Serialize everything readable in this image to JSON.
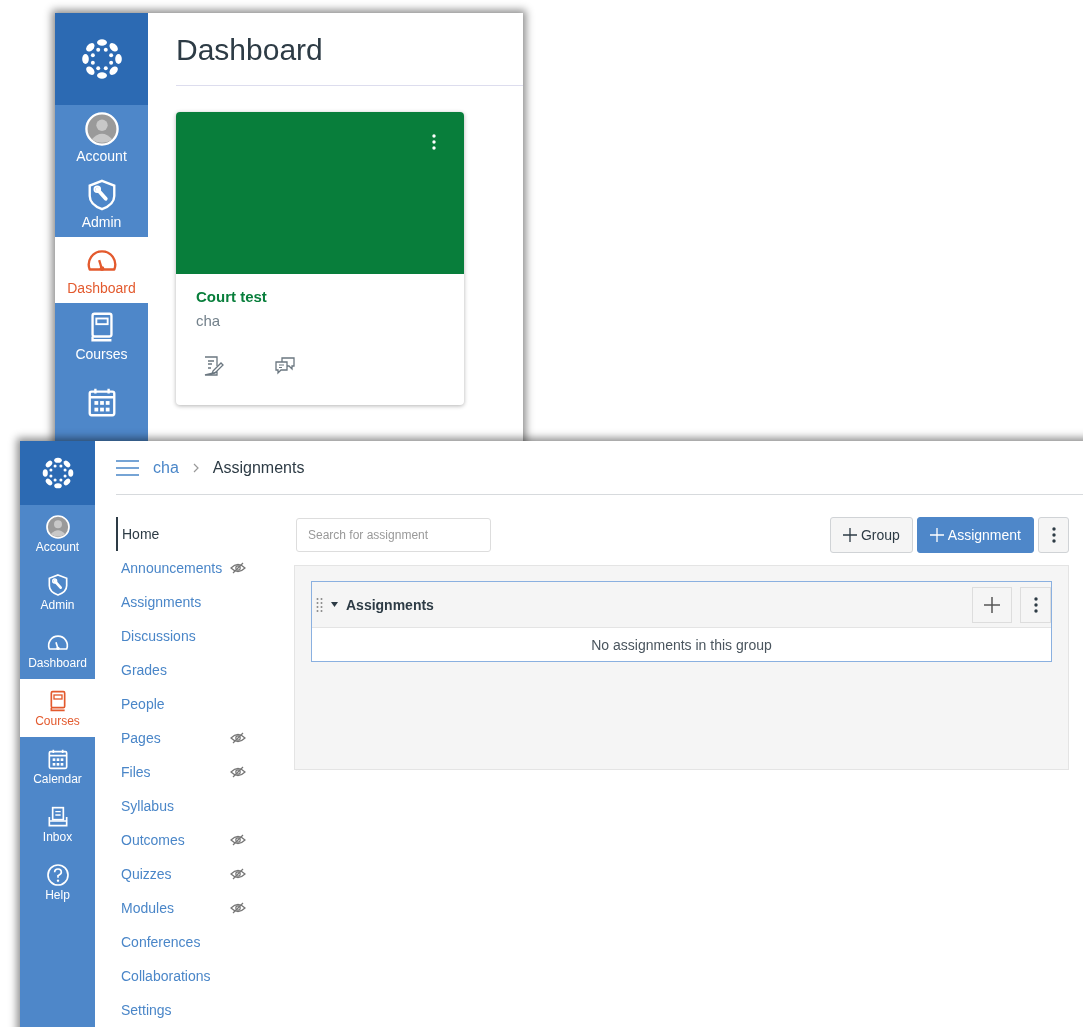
{
  "dashboard_window": {
    "global_nav": [
      {
        "kind": "account",
        "label": "Account",
        "selected": false
      },
      {
        "kind": "admin",
        "label": "Admin",
        "selected": false
      },
      {
        "kind": "dashboard",
        "label": "Dashboard",
        "selected": true
      },
      {
        "kind": "courses",
        "label": "Courses",
        "selected": false
      },
      {
        "kind": "calendar",
        "selected": false
      }
    ],
    "title": "Dashboard",
    "course_card": {
      "color": "#087e3b",
      "name": "Court test",
      "code": "cha"
    }
  },
  "assignments_window": {
    "global_nav": [
      {
        "kind": "account",
        "label": "Account",
        "selected": false
      },
      {
        "kind": "admin",
        "label": "Admin",
        "selected": false
      },
      {
        "kind": "dashboard",
        "label": "Dashboard",
        "selected": false
      },
      {
        "kind": "courses",
        "label": "Courses",
        "selected": true
      },
      {
        "kind": "calendar",
        "label": "Calendar",
        "selected": false
      },
      {
        "kind": "inbox",
        "label": "Inbox",
        "selected": false
      },
      {
        "kind": "help",
        "label": "Help",
        "selected": false
      }
    ],
    "breadcrumb": [
      "cha",
      "Assignments"
    ],
    "course_nav": [
      {
        "label": "Home",
        "selected": true,
        "hidden": false
      },
      {
        "label": "Announcements",
        "selected": false,
        "hidden": true
      },
      {
        "label": "Assignments",
        "selected": false,
        "hidden": false
      },
      {
        "label": "Discussions",
        "selected": false,
        "hidden": false
      },
      {
        "label": "Grades",
        "selected": false,
        "hidden": false
      },
      {
        "label": "People",
        "selected": false,
        "hidden": false
      },
      {
        "label": "Pages",
        "selected": false,
        "hidden": true
      },
      {
        "label": "Files",
        "selected": false,
        "hidden": true
      },
      {
        "label": "Syllabus",
        "selected": false,
        "hidden": false
      },
      {
        "label": "Outcomes",
        "selected": false,
        "hidden": true
      },
      {
        "label": "Quizzes",
        "selected": false,
        "hidden": true
      },
      {
        "label": "Modules",
        "selected": false,
        "hidden": true
      },
      {
        "label": "Conferences",
        "selected": false,
        "hidden": false
      },
      {
        "label": "Collaborations",
        "selected": false,
        "hidden": false
      },
      {
        "label": "Settings",
        "selected": false,
        "hidden": false
      }
    ],
    "search": {
      "placeholder": "Search for assignment"
    },
    "buttons": [
      {
        "label": "Group",
        "kind": "default"
      },
      {
        "label": "Assignment",
        "kind": "primary"
      }
    ],
    "group": {
      "title": "Assignments",
      "empty_message": "No assignments in this group"
    }
  }
}
